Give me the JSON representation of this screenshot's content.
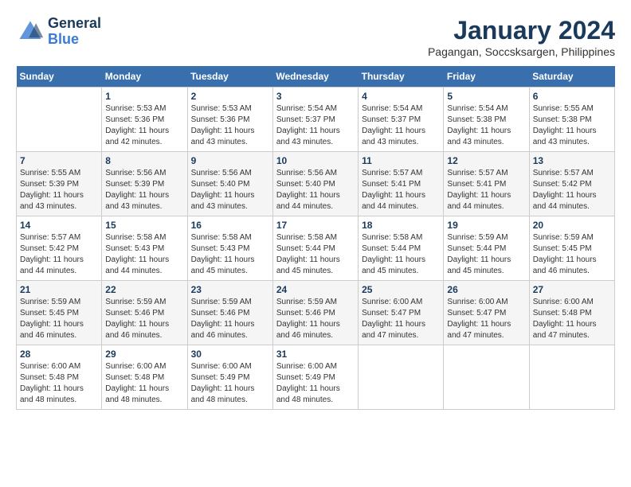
{
  "logo": {
    "line1": "General",
    "line2": "Blue"
  },
  "title": "January 2024",
  "subtitle": "Pagangan, Soccsksargen, Philippines",
  "days_header": [
    "Sunday",
    "Monday",
    "Tuesday",
    "Wednesday",
    "Thursday",
    "Friday",
    "Saturday"
  ],
  "weeks": [
    [
      {
        "num": "",
        "sunrise": "",
        "sunset": "",
        "daylight": ""
      },
      {
        "num": "1",
        "sunrise": "Sunrise: 5:53 AM",
        "sunset": "Sunset: 5:36 PM",
        "daylight": "Daylight: 11 hours and 42 minutes."
      },
      {
        "num": "2",
        "sunrise": "Sunrise: 5:53 AM",
        "sunset": "Sunset: 5:36 PM",
        "daylight": "Daylight: 11 hours and 43 minutes."
      },
      {
        "num": "3",
        "sunrise": "Sunrise: 5:54 AM",
        "sunset": "Sunset: 5:37 PM",
        "daylight": "Daylight: 11 hours and 43 minutes."
      },
      {
        "num": "4",
        "sunrise": "Sunrise: 5:54 AM",
        "sunset": "Sunset: 5:37 PM",
        "daylight": "Daylight: 11 hours and 43 minutes."
      },
      {
        "num": "5",
        "sunrise": "Sunrise: 5:54 AM",
        "sunset": "Sunset: 5:38 PM",
        "daylight": "Daylight: 11 hours and 43 minutes."
      },
      {
        "num": "6",
        "sunrise": "Sunrise: 5:55 AM",
        "sunset": "Sunset: 5:38 PM",
        "daylight": "Daylight: 11 hours and 43 minutes."
      }
    ],
    [
      {
        "num": "7",
        "sunrise": "Sunrise: 5:55 AM",
        "sunset": "Sunset: 5:39 PM",
        "daylight": "Daylight: 11 hours and 43 minutes."
      },
      {
        "num": "8",
        "sunrise": "Sunrise: 5:56 AM",
        "sunset": "Sunset: 5:39 PM",
        "daylight": "Daylight: 11 hours and 43 minutes."
      },
      {
        "num": "9",
        "sunrise": "Sunrise: 5:56 AM",
        "sunset": "Sunset: 5:40 PM",
        "daylight": "Daylight: 11 hours and 43 minutes."
      },
      {
        "num": "10",
        "sunrise": "Sunrise: 5:56 AM",
        "sunset": "Sunset: 5:40 PM",
        "daylight": "Daylight: 11 hours and 44 minutes."
      },
      {
        "num": "11",
        "sunrise": "Sunrise: 5:57 AM",
        "sunset": "Sunset: 5:41 PM",
        "daylight": "Daylight: 11 hours and 44 minutes."
      },
      {
        "num": "12",
        "sunrise": "Sunrise: 5:57 AM",
        "sunset": "Sunset: 5:41 PM",
        "daylight": "Daylight: 11 hours and 44 minutes."
      },
      {
        "num": "13",
        "sunrise": "Sunrise: 5:57 AM",
        "sunset": "Sunset: 5:42 PM",
        "daylight": "Daylight: 11 hours and 44 minutes."
      }
    ],
    [
      {
        "num": "14",
        "sunrise": "Sunrise: 5:57 AM",
        "sunset": "Sunset: 5:42 PM",
        "daylight": "Daylight: 11 hours and 44 minutes."
      },
      {
        "num": "15",
        "sunrise": "Sunrise: 5:58 AM",
        "sunset": "Sunset: 5:43 PM",
        "daylight": "Daylight: 11 hours and 44 minutes."
      },
      {
        "num": "16",
        "sunrise": "Sunrise: 5:58 AM",
        "sunset": "Sunset: 5:43 PM",
        "daylight": "Daylight: 11 hours and 45 minutes."
      },
      {
        "num": "17",
        "sunrise": "Sunrise: 5:58 AM",
        "sunset": "Sunset: 5:44 PM",
        "daylight": "Daylight: 11 hours and 45 minutes."
      },
      {
        "num": "18",
        "sunrise": "Sunrise: 5:58 AM",
        "sunset": "Sunset: 5:44 PM",
        "daylight": "Daylight: 11 hours and 45 minutes."
      },
      {
        "num": "19",
        "sunrise": "Sunrise: 5:59 AM",
        "sunset": "Sunset: 5:44 PM",
        "daylight": "Daylight: 11 hours and 45 minutes."
      },
      {
        "num": "20",
        "sunrise": "Sunrise: 5:59 AM",
        "sunset": "Sunset: 5:45 PM",
        "daylight": "Daylight: 11 hours and 46 minutes."
      }
    ],
    [
      {
        "num": "21",
        "sunrise": "Sunrise: 5:59 AM",
        "sunset": "Sunset: 5:45 PM",
        "daylight": "Daylight: 11 hours and 46 minutes."
      },
      {
        "num": "22",
        "sunrise": "Sunrise: 5:59 AM",
        "sunset": "Sunset: 5:46 PM",
        "daylight": "Daylight: 11 hours and 46 minutes."
      },
      {
        "num": "23",
        "sunrise": "Sunrise: 5:59 AM",
        "sunset": "Sunset: 5:46 PM",
        "daylight": "Daylight: 11 hours and 46 minutes."
      },
      {
        "num": "24",
        "sunrise": "Sunrise: 5:59 AM",
        "sunset": "Sunset: 5:46 PM",
        "daylight": "Daylight: 11 hours and 46 minutes."
      },
      {
        "num": "25",
        "sunrise": "Sunrise: 6:00 AM",
        "sunset": "Sunset: 5:47 PM",
        "daylight": "Daylight: 11 hours and 47 minutes."
      },
      {
        "num": "26",
        "sunrise": "Sunrise: 6:00 AM",
        "sunset": "Sunset: 5:47 PM",
        "daylight": "Daylight: 11 hours and 47 minutes."
      },
      {
        "num": "27",
        "sunrise": "Sunrise: 6:00 AM",
        "sunset": "Sunset: 5:48 PM",
        "daylight": "Daylight: 11 hours and 47 minutes."
      }
    ],
    [
      {
        "num": "28",
        "sunrise": "Sunrise: 6:00 AM",
        "sunset": "Sunset: 5:48 PM",
        "daylight": "Daylight: 11 hours and 48 minutes."
      },
      {
        "num": "29",
        "sunrise": "Sunrise: 6:00 AM",
        "sunset": "Sunset: 5:48 PM",
        "daylight": "Daylight: 11 hours and 48 minutes."
      },
      {
        "num": "30",
        "sunrise": "Sunrise: 6:00 AM",
        "sunset": "Sunset: 5:49 PM",
        "daylight": "Daylight: 11 hours and 48 minutes."
      },
      {
        "num": "31",
        "sunrise": "Sunrise: 6:00 AM",
        "sunset": "Sunset: 5:49 PM",
        "daylight": "Daylight: 11 hours and 48 minutes."
      },
      {
        "num": "",
        "sunrise": "",
        "sunset": "",
        "daylight": ""
      },
      {
        "num": "",
        "sunrise": "",
        "sunset": "",
        "daylight": ""
      },
      {
        "num": "",
        "sunrise": "",
        "sunset": "",
        "daylight": ""
      }
    ]
  ]
}
